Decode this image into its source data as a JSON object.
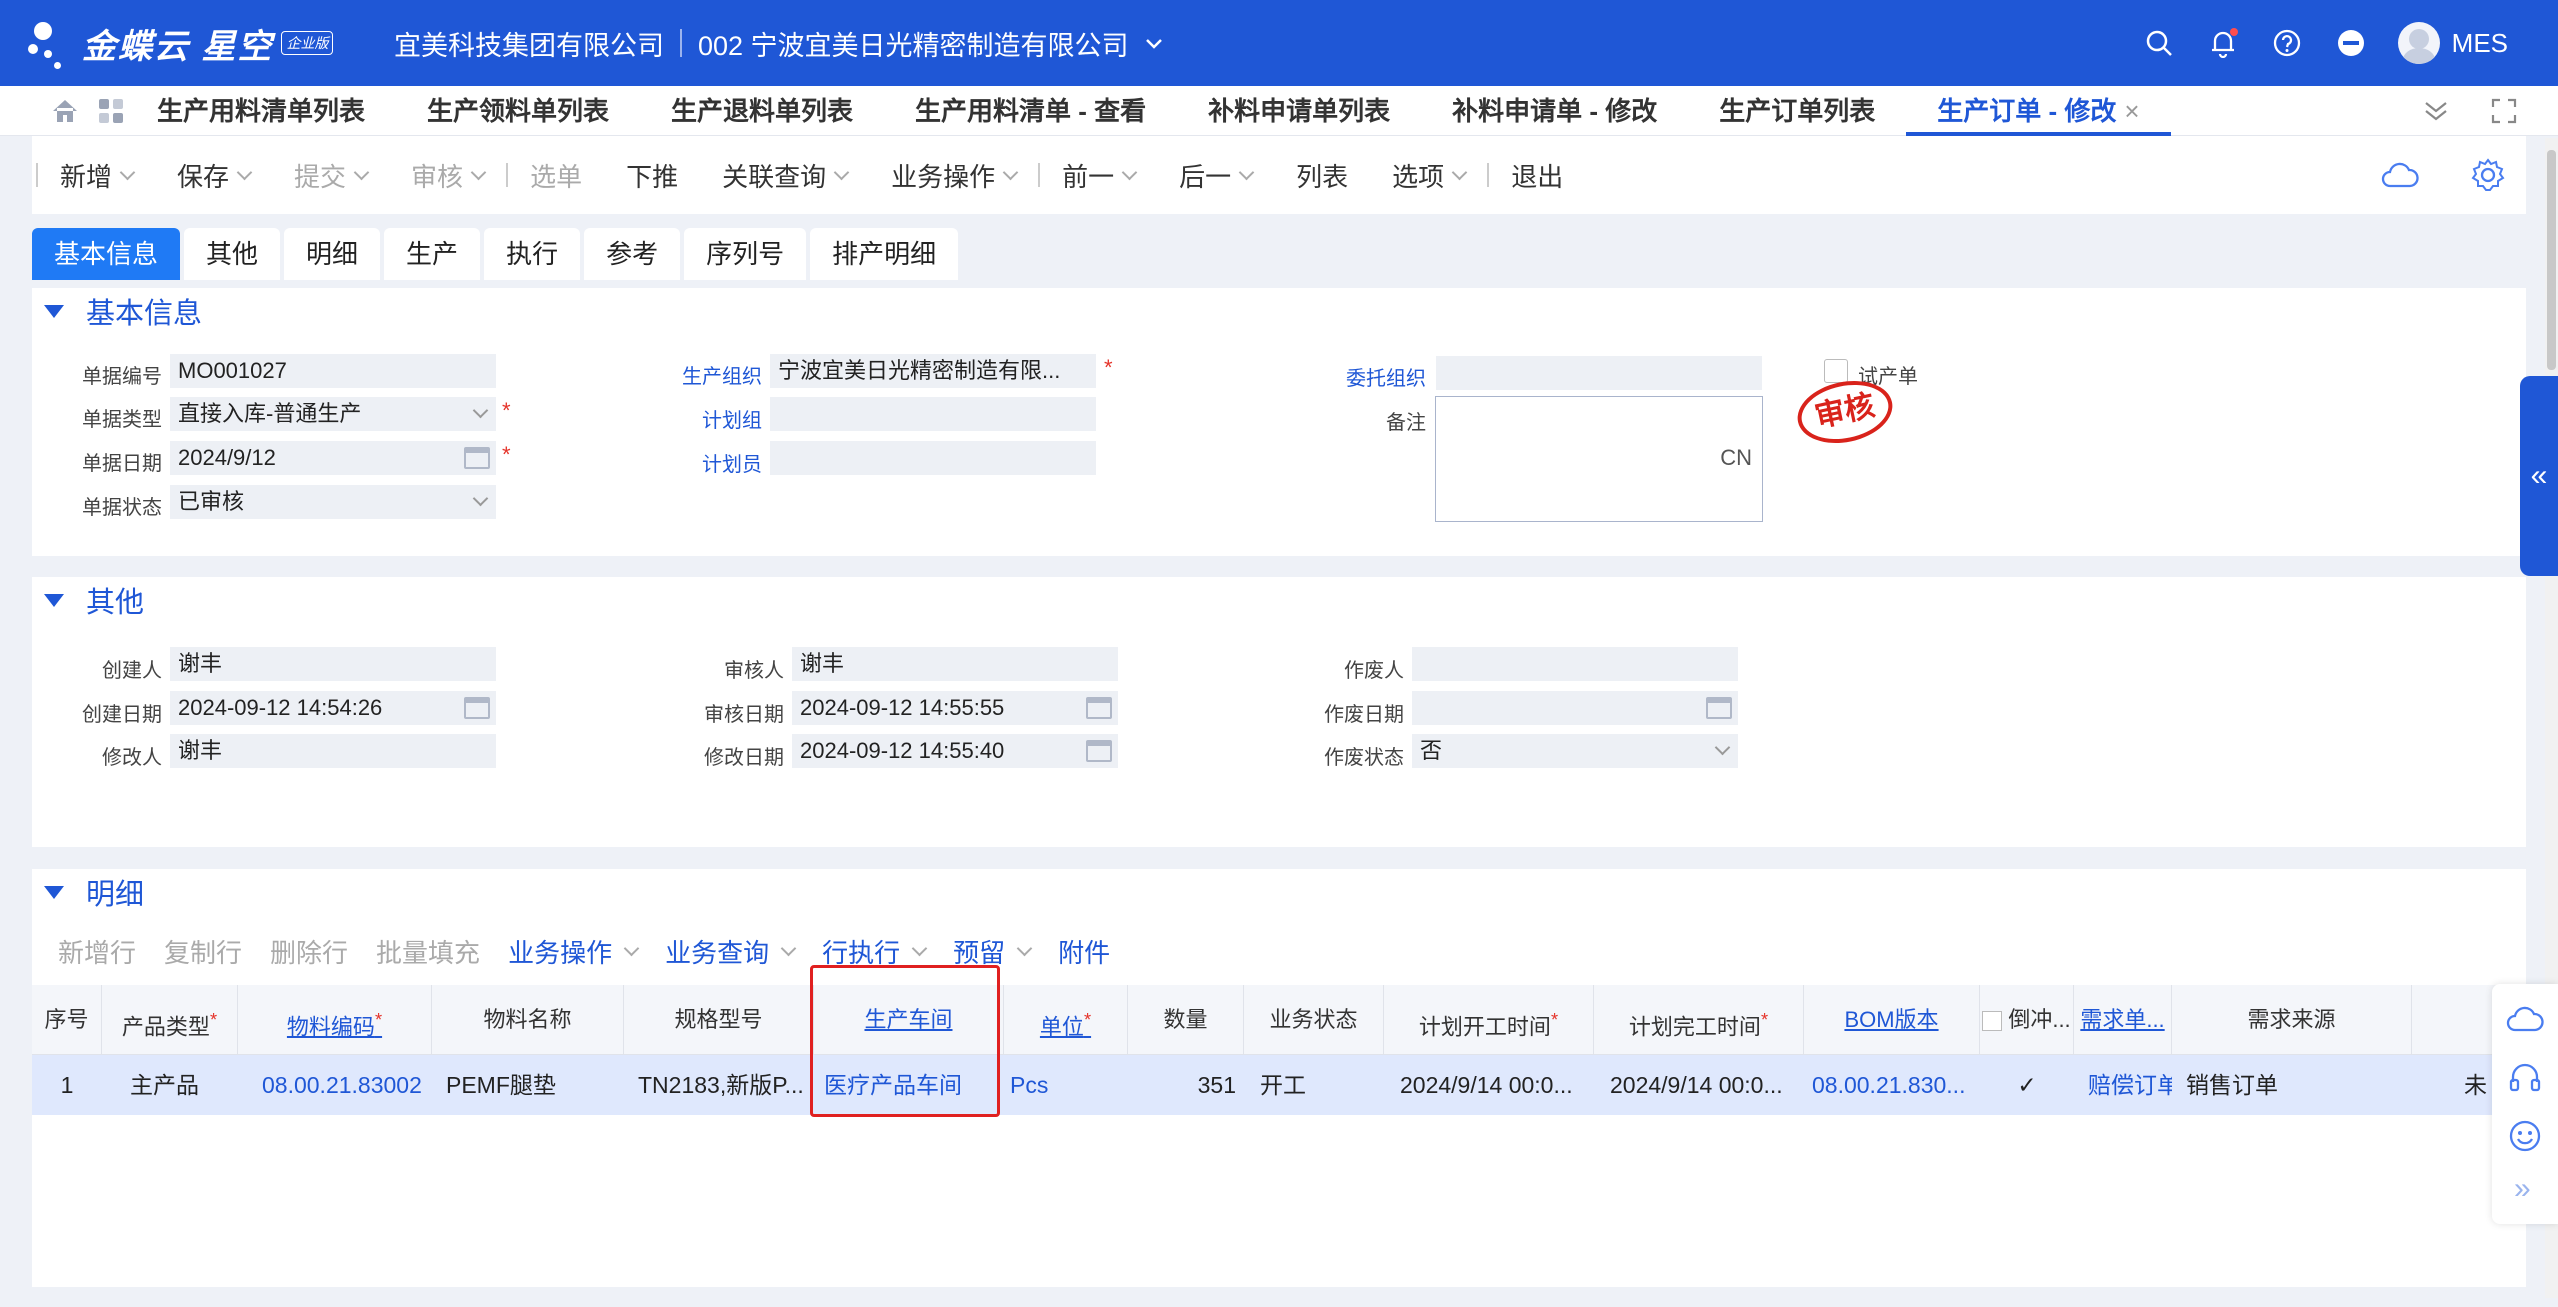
{
  "app": {
    "logo_text": "金蝶云 星空",
    "edition_badge": "企业版",
    "company": "宜美科技集团有限公司",
    "org": "002 宁波宜美日光精密制造有限公司",
    "user": "MES"
  },
  "tabs": [
    "生产用料清单列表",
    "生产领料单列表",
    "生产退料单列表",
    "生产用料清单 - 查看",
    "补料申请单列表",
    "补料申请单 - 修改",
    "生产订单列表",
    "生产订单 - 修改"
  ],
  "toolbar": {
    "add": "新增",
    "save": "保存",
    "submit": "提交",
    "audit": "审核",
    "select": "选单",
    "push": "下推",
    "linked_query": "关联查询",
    "biz_ops": "业务操作",
    "prev": "前一",
    "next": "后一",
    "list": "列表",
    "options": "选项",
    "exit": "退出"
  },
  "subtabs": [
    "基本信息",
    "其他",
    "明细",
    "生产",
    "执行",
    "参考",
    "序列号",
    "排产明细"
  ],
  "basic": {
    "title": "基本信息",
    "bill_no_label": "单据编号",
    "bill_no": "MO001027",
    "bill_type_label": "单据类型",
    "bill_type": "直接入库-普通生产",
    "bill_date_label": "单据日期",
    "bill_date": "2024/9/12",
    "bill_status_label": "单据状态",
    "bill_status": "已审核",
    "prod_org_label": "生产组织",
    "prod_org": "宁波宜美日光精密制造有限...",
    "plan_group_label": "计划组",
    "planner_label": "计划员",
    "entrust_org_label": "委托组织",
    "remark_label": "备注",
    "remark_lang": "CN",
    "trial_label": "试产单",
    "stamp": "审核"
  },
  "other": {
    "title": "其他",
    "creator_label": "创建人",
    "creator": "谢丰",
    "create_date_label": "创建日期",
    "create_date": "2024-09-12 14:54:26",
    "modifier_label": "修改人",
    "modifier": "谢丰",
    "auditor_label": "审核人",
    "auditor": "谢丰",
    "audit_date_label": "审核日期",
    "audit_date": "2024-09-12 14:55:55",
    "modify_date_label": "修改日期",
    "modify_date": "2024-09-12 14:55:40",
    "voider_label": "作废人",
    "void_date_label": "作废日期",
    "void_status_label": "作废状态",
    "void_status": "否"
  },
  "detail": {
    "title": "明细",
    "actions": {
      "new_row": "新增行",
      "copy_row": "复制行",
      "delete_row": "删除行",
      "batch_fill": "批量填充",
      "biz_ops": "业务操作",
      "biz_query": "业务查询",
      "row_exec": "行执行",
      "reserve": "预留",
      "attachment": "附件"
    },
    "columns": [
      "序号",
      "产品类型",
      "物料编码",
      "物料名称",
      "规格型号",
      "生产车间",
      "单位",
      "数量",
      "业务状态",
      "计划开工时间",
      "计划完工时间",
      "BOM版本",
      "倒冲...",
      "需求单...",
      "需求来源"
    ],
    "rows": [
      {
        "seq": "1",
        "product_type": "主产品",
        "material_code": "08.00.21.83002",
        "material_name": "PEMF腿垫",
        "spec": "TN2183,新版P...",
        "workshop": "医疗产品车间",
        "unit": "Pcs",
        "qty": "351",
        "status": "开工",
        "plan_start": "2024/9/14 00:0...",
        "plan_end": "2024/9/14 00:0...",
        "bom": "08.00.21.830...",
        "backflush": "✓",
        "demand_no": "赔偿订单",
        "demand_src": "销售订单",
        "extra": "未"
      }
    ]
  }
}
